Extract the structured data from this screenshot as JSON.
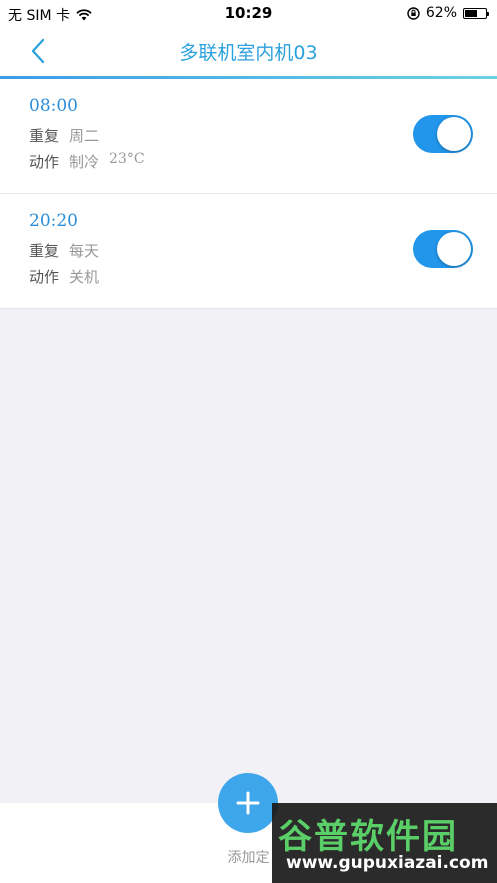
{
  "status_bar": {
    "carrier": "无 SIM 卡",
    "time": "10:29",
    "battery_percent": "62%",
    "battery_level": 0.62
  },
  "nav": {
    "title": "多联机室内机03"
  },
  "colors": {
    "accent": "#2aa1dc",
    "toggle_on": "#2196ea",
    "add_button": "#3ea6ea"
  },
  "timers": [
    {
      "time": "08:00",
      "repeat_label": "重复",
      "repeat_value": "周二",
      "action_label": "动作",
      "action_value": "制冷",
      "temperature": "23°C",
      "enabled": true
    },
    {
      "time": "20:20",
      "repeat_label": "重复",
      "repeat_value": "每天",
      "action_label": "动作",
      "action_value": "关机",
      "enabled": true
    }
  ],
  "add": {
    "label": "添加定"
  },
  "watermark": {
    "title": "谷普软件园",
    "url": "www.gupuxiazai.com"
  }
}
